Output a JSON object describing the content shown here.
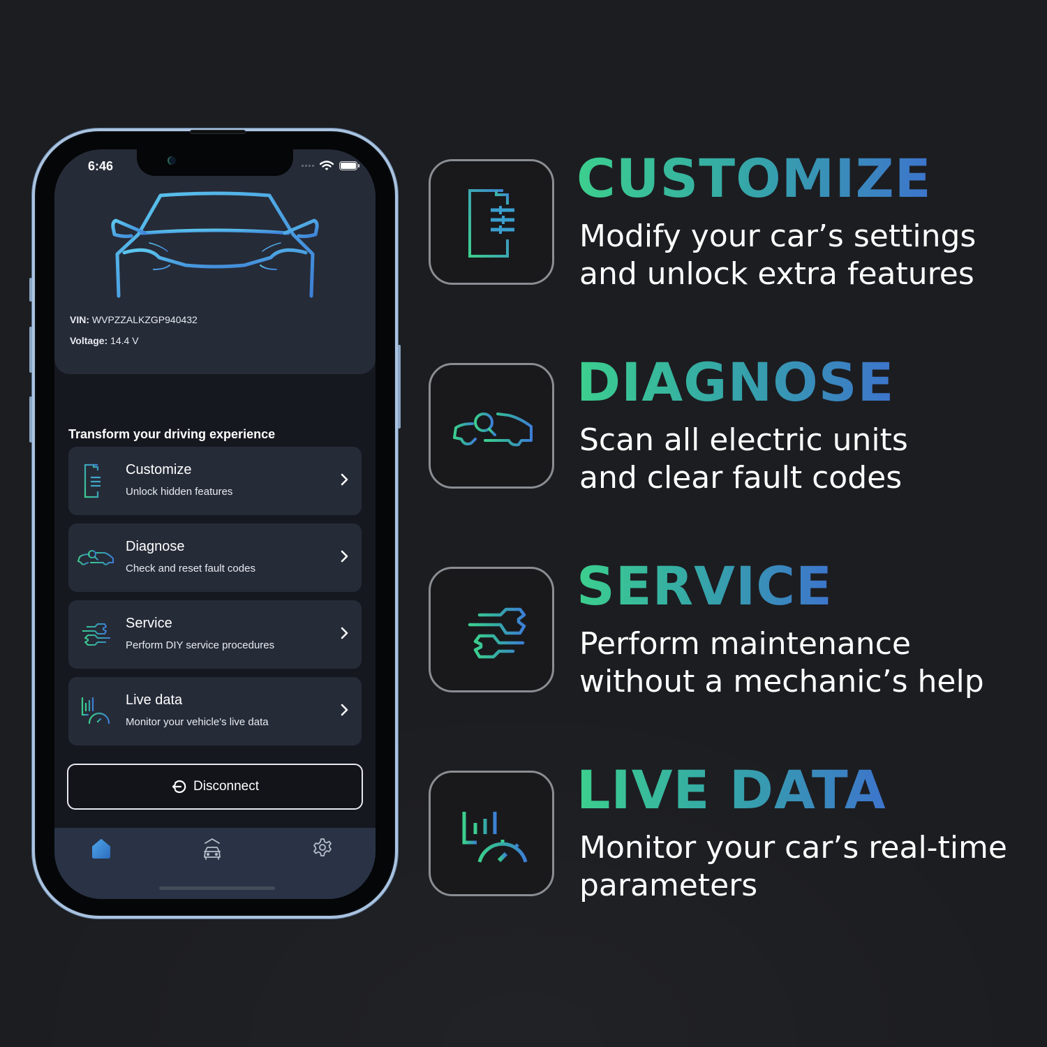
{
  "phone": {
    "status_bar": {
      "time": "6:46",
      "wifi_icon": "wifi-icon",
      "battery_icon": "battery-icon"
    },
    "vehicle": {
      "vin_label": "VIN:",
      "vin_value": "WVPZZALKZGP940432",
      "voltage_label": "Voltage:",
      "voltage_value": "14.4 V"
    },
    "section_title": "Transform your driving experience",
    "menu_items": [
      {
        "title": "Customize",
        "subtitle": "Unlock hidden features",
        "icon": "customize-sliders-icon"
      },
      {
        "title": "Diagnose",
        "subtitle": "Check and reset fault codes",
        "icon": "car-search-icon"
      },
      {
        "title": "Service",
        "subtitle": "Perform DIY service procedures",
        "icon": "wrenches-icon"
      },
      {
        "title": "Live data",
        "subtitle": "Monitor your vehicle's live data",
        "icon": "gauge-chart-icon"
      }
    ],
    "disconnect_label": "Disconnect",
    "tabbar": [
      {
        "name": "home",
        "icon": "home-icon",
        "active": true
      },
      {
        "name": "garage",
        "icon": "garage-car-icon",
        "active": false
      },
      {
        "name": "settings",
        "icon": "gear-icon",
        "active": false
      }
    ]
  },
  "features": [
    {
      "title": "CUSTOMIZE",
      "lines": [
        "Modify your car’s settings",
        "and unlock extra features"
      ],
      "icon": "customize-sliders-icon"
    },
    {
      "title": "DIAGNOSE",
      "lines": [
        "Scan all electric units",
        "and clear fault codes"
      ],
      "icon": "car-search-icon"
    },
    {
      "title": "SERVICE",
      "lines": [
        "Perform maintenance",
        "without a mechanic’s help"
      ],
      "icon": "wrenches-icon"
    },
    {
      "title": "LIVE DATA",
      "lines": [
        "Monitor your car’s real-time",
        "parameters"
      ],
      "icon": "gauge-chart-icon"
    }
  ],
  "colors": {
    "accent_green": "#3ccf8e",
    "accent_teal": "#35a9a6",
    "accent_blue": "#3d74cc",
    "car_outline": "#4fb3e6",
    "card_bg": "#262b38",
    "background": "#1c1d21"
  }
}
